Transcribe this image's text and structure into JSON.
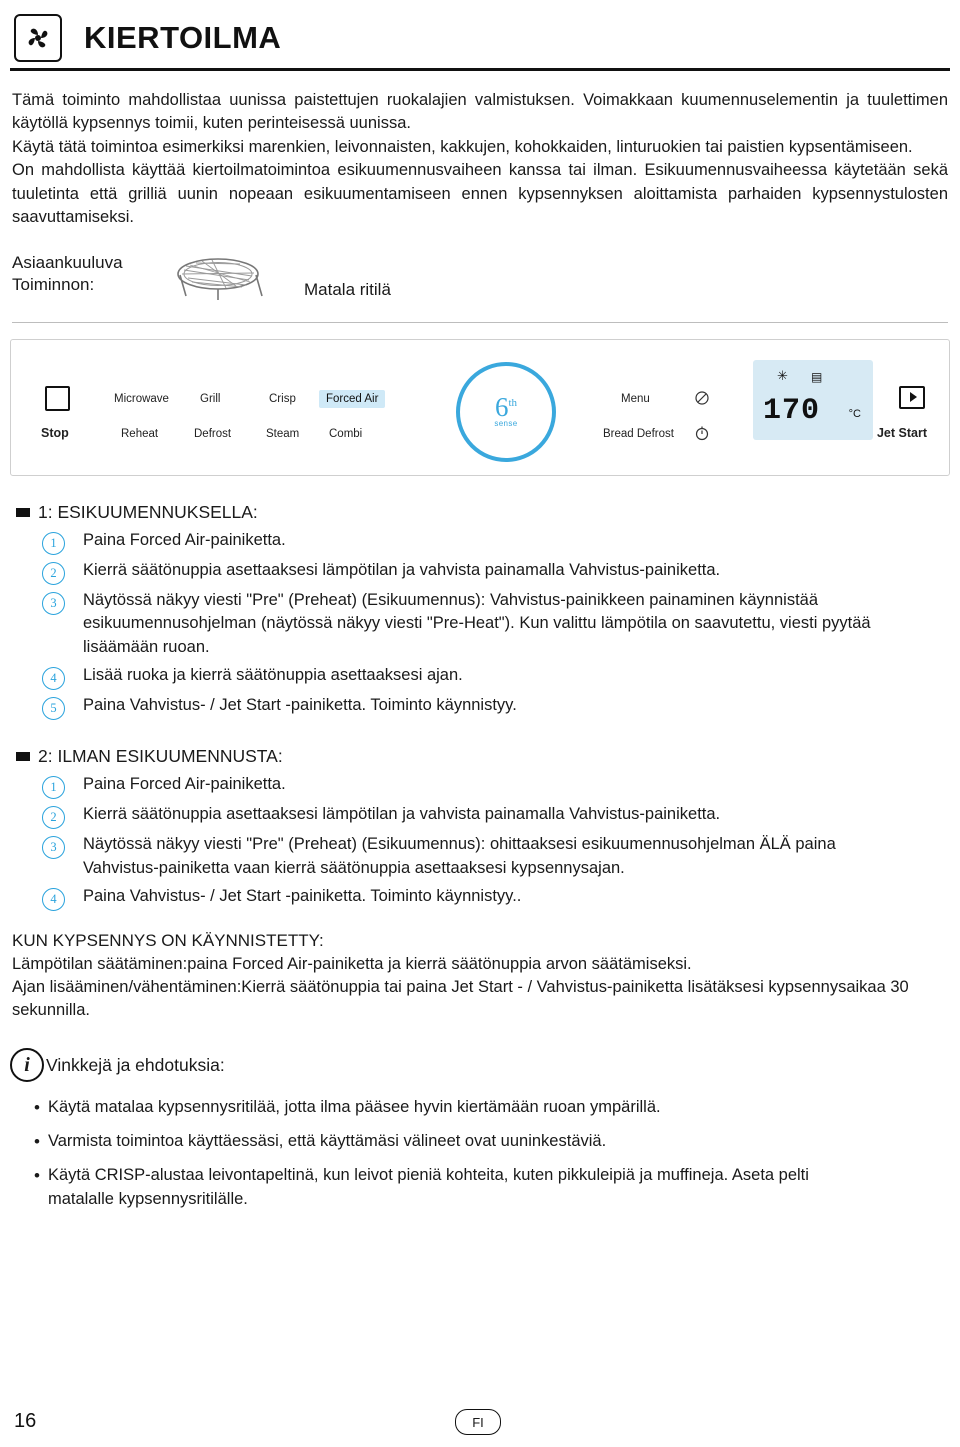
{
  "header": {
    "title": "KIERTOILMA",
    "icon": "fan-icon"
  },
  "intro": {
    "paragraphs": [
      "Tämä toiminto mahdollistaa uunissa paistettujen ruokalajien valmistuksen. Voimakkaan kuumennuselementin ja tuulettimen käytöllä kypsennys toimii, kuten perinteisessä uunissa.",
      "Käytä tätä toimintoa esimerkiksi marenkien, leivonnaisten, kakkujen, kohokkaiden, linturuokien tai paistien kypsentämiseen.",
      "On mahdollista käyttää kiertoilmatoimintoa esikuumennusvaiheen kanssa tai ilman. Esikuumennusvaiheessa käytetään sekä tuuletinta että grilliä uunin nopeaan esikuumentamiseen ennen kypsennyksen aloittamista parhaiden kypsennystulosten saavuttamiseksi."
    ]
  },
  "accessory": {
    "label_line1": "Asiaankuuluva",
    "label_line2": "Toiminnon:",
    "caption": "Matala ritilä",
    "icon": "low-wire-rack-icon"
  },
  "panel": {
    "stop_label": "Stop",
    "top_row": [
      "Microwave",
      "Grill",
      "Crisp",
      "Forced Air"
    ],
    "bottom_row": [
      "Reheat",
      "Defrost",
      "Steam",
      "Combi"
    ],
    "highlighted": "Forced Air",
    "menu_label": "Menu",
    "bread_defrost_label": "Bread Defrost",
    "dial_number": "6",
    "dial_sup": "th",
    "dial_sense": "sense",
    "display_value": "170",
    "display_unit": "°C",
    "jet_start_label": "Jet Start",
    "accent_color": "#3aa8dd",
    "highlight_color": "#cfe9f7",
    "display_bg": "#d7eaf4"
  },
  "section1": {
    "title": "1: ESIKUUMENNUKSELLA:",
    "steps": [
      "Paina Forced Air-painiketta.",
      "Kierrä säätönuppia asettaaksesi lämpötilan ja vahvista painamalla Vahvistus-painiketta.",
      "Näytössä näkyy viesti \"Pre\" (Preheat) (Esikuumennus): Vahvistus-painikkeen painaminen käynnistää esikuumennusohjelman (näytössä näkyy viesti \"Pre-Heat\"). Kun valittu lämpötila on saavutettu, viesti pyytää lisäämään ruoan.",
      "Lisää ruoka ja kierrä säätönuppia asettaaksesi ajan.",
      "Paina Vahvistus- / Jet Start -painiketta. Toiminto käynnistyy."
    ],
    "numbers": [
      "1",
      "2",
      "3",
      "4",
      "5"
    ]
  },
  "section2": {
    "title": "2: ILMAN ESIKUUMENNUSTA:",
    "steps": [
      "Paina Forced Air-painiketta.",
      "Kierrä säätönuppia asettaaksesi lämpötilan ja vahvista painamalla Vahvistus-painiketta.",
      "Näytössä näkyy viesti \"Pre\" (Preheat) (Esikuumennus): ohittaaksesi esikuumennusohjelman ÄLÄ paina Vahvistus-painiketta vaan kierrä säätönuppia asettaaksesi kypsennysajan.",
      "Paina Vahvistus- / Jet Start -painiketta. Toiminto käynnistyy.."
    ],
    "numbers": [
      "1",
      "2",
      "3",
      "4"
    ]
  },
  "after_start": {
    "title": "KUN KYPSENNYS ON KÄYNNISTETTY:",
    "lines": [
      "Lämpötilan säätäminen:paina Forced Air-painiketta ja kierrä säätönuppia arvon säätämiseksi.",
      "Ajan lisääminen/vähentäminen:Kierrä säätönuppia tai paina Jet Start - / Vahvistus-painiketta lisätäksesi kypsennysaikaa 30 sekunnilla."
    ]
  },
  "tips": {
    "title": "Vinkkejä ja ehdotuksia:",
    "items": [
      "Käytä matalaa kypsennysritilää, jotta ilma pääsee hyvin kiertämään ruoan ympärillä.",
      "Varmista toimintoa käyttäessäsi, että käyttämäsi välineet ovat uuninkestäviä.",
      "Käytä CRISP-alustaa leivontapeltinä, kun leivot pieniä kohteita, kuten pikkuleipiä ja muffineja. Aseta pelti matalalle kypsennysritilälle."
    ]
  },
  "footer": {
    "page_number": "16",
    "language": "FI"
  }
}
